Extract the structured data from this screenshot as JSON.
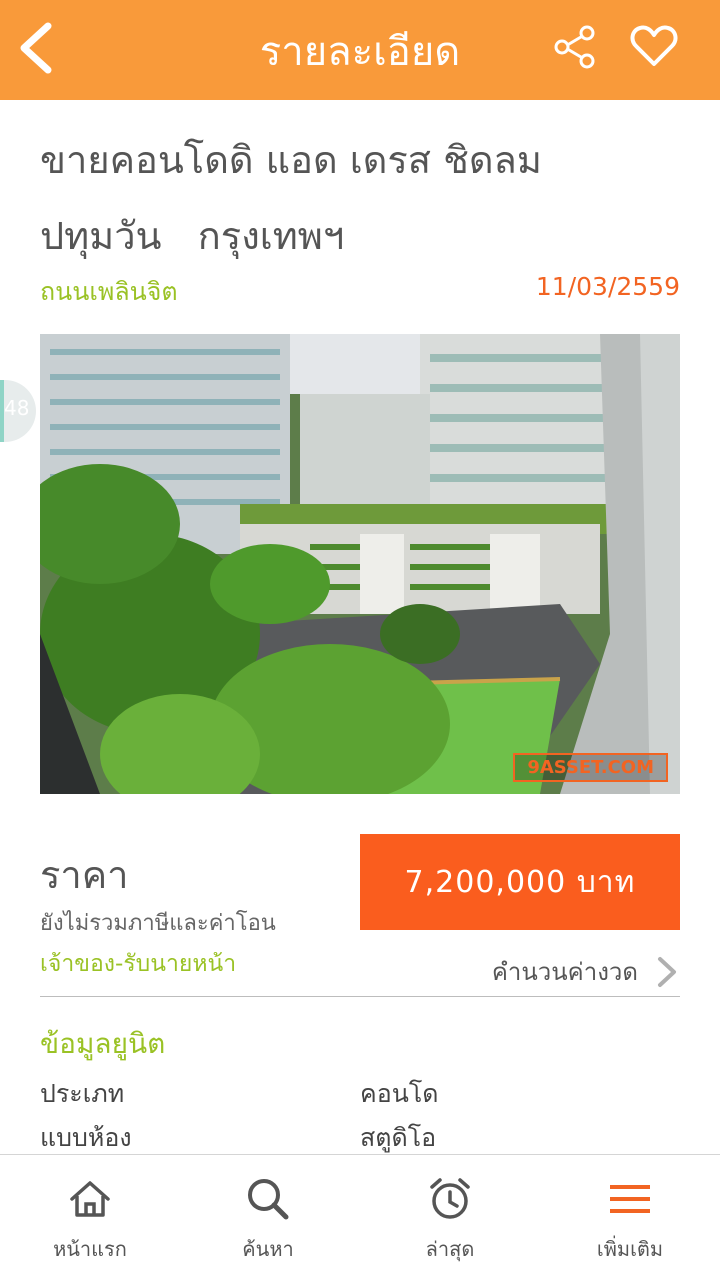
{
  "header": {
    "title": "รายละเอียด",
    "back_icon": "back-arrow-icon",
    "share_icon": "share-icon",
    "favorite_icon": "heart-icon",
    "color": "#f99a3a"
  },
  "listing": {
    "title_line1": "ขายคอนโดดิ แอด เดรส ชิดลม",
    "title_line2": "ปทุมวัน   กรุงเทพฯ",
    "road": "ถนนเพลินจิต",
    "date": "11/03/2559",
    "watermark": "9ASSET.COM",
    "side_badge": "48",
    "price_label": "ราคา",
    "price_note": "ยังไม่รวมภาษีและค่าโอน",
    "price": "7,200,000 บาท",
    "agent": "เจ้าของ-รับนายหน้า",
    "calc_label": "คำนวนค่างวด"
  },
  "specs": {
    "section_title": "ข้อมูลยูนิต",
    "rows": [
      {
        "key": "ประเภท",
        "value": "คอนโด"
      },
      {
        "key": "แบบห้อง",
        "value": "สตูดิโอ"
      }
    ]
  },
  "nav": {
    "items": [
      {
        "label": "หน้าแรก",
        "icon": "home-icon"
      },
      {
        "label": "ค้นหา",
        "icon": "search-icon"
      },
      {
        "label": "ล่าสุด",
        "icon": "alarm-clock-icon"
      },
      {
        "label": "เพิ่มเติม",
        "icon": "menu-icon"
      }
    ]
  },
  "colors": {
    "accent_green": "#9ac225",
    "accent_orange": "#f26422",
    "price_box": "#fa5d1e"
  }
}
